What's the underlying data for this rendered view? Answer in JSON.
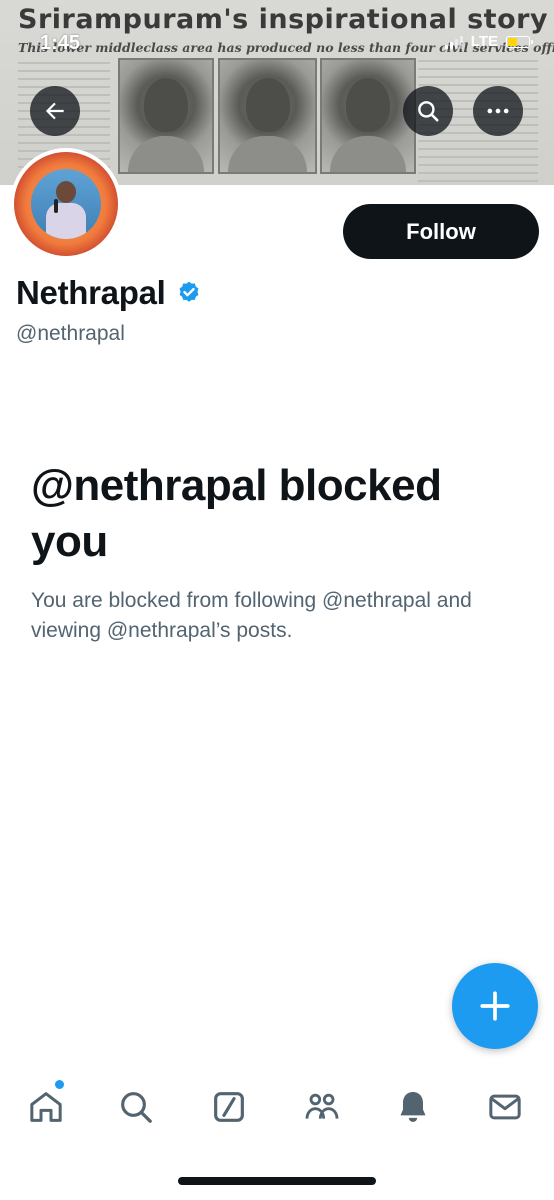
{
  "status_bar": {
    "time": "1:45",
    "network": "LTE"
  },
  "banner": {
    "headline": "Srirampuram's inspirational story",
    "subheadline": "This lower middleclass area has produced no less than four civil services officers"
  },
  "header_actions": {
    "back_icon": "arrow-left-icon",
    "search_icon": "search-icon",
    "more_icon": "more-horizontal-icon"
  },
  "profile": {
    "display_name": "Nethrapal",
    "handle": "@nethrapal",
    "verified": true,
    "follow_label": "Follow"
  },
  "blocked": {
    "title": "@nethrapal blocked you",
    "description": "You are blocked from following @nethrapal and viewing @nethrapal’s posts."
  },
  "fab": {
    "icon": "plus-icon"
  },
  "bottom_nav": [
    {
      "id": "home",
      "icon": "home-icon",
      "has_notification_dot": true
    },
    {
      "id": "search",
      "icon": "search-icon"
    },
    {
      "id": "grok",
      "icon": "grok-icon"
    },
    {
      "id": "communities",
      "icon": "communities-icon"
    },
    {
      "id": "notifications",
      "icon": "bell-icon"
    },
    {
      "id": "messages",
      "icon": "mail-icon"
    }
  ],
  "colors": {
    "accent": "#1d9bf0",
    "text_primary": "#0f1419",
    "text_secondary": "#536471",
    "follow_button_bg": "#0f1419",
    "battery_fill": "#ffd60a"
  }
}
